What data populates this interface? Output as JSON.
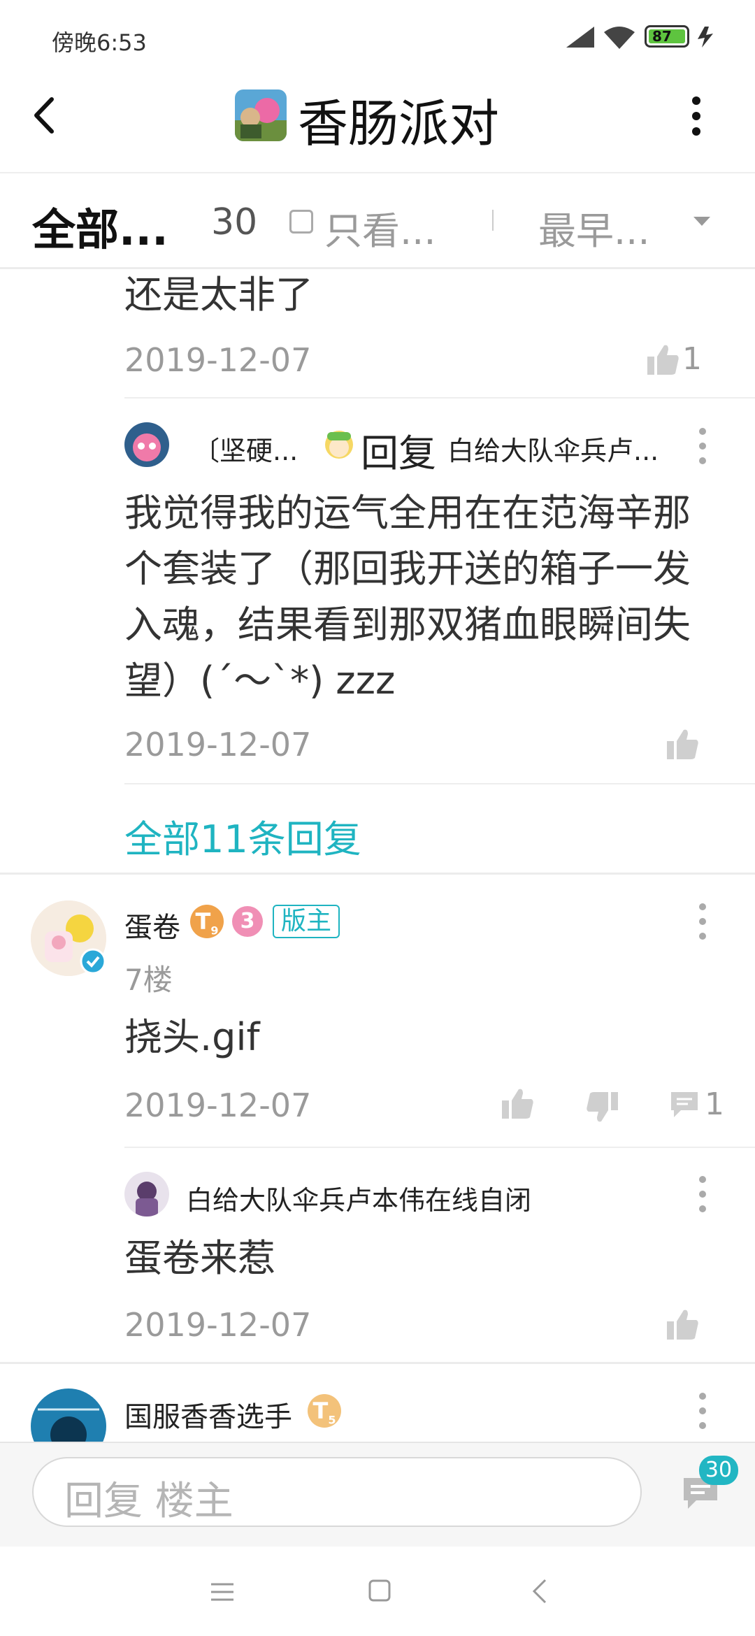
{
  "status_bar": {
    "time": "傍晚6:53",
    "battery": "87"
  },
  "header": {
    "title": "香肠派对"
  },
  "filter": {
    "all_label": "全部...",
    "count": "30",
    "only_label": "只看...",
    "sort_label": "最早..."
  },
  "thread": {
    "prev_reply": {
      "text": "还是太非了",
      "date": "2019-12-07",
      "likes": "1"
    },
    "reply2": {
      "author": "〔坚硬...",
      "reply_word": "回复",
      "reply_to": "白给大队伞兵卢...",
      "text": "我觉得我的运气全用在在范海辛那个套装了（那回我开送的箱子一发入魂，结果看到那双猪血眼瞬间失望）(´～`*) zzz",
      "date": "2019-12-07"
    },
    "view_all": "全部11条回复"
  },
  "post7": {
    "author": "蛋卷",
    "level_badge": "T",
    "level_sub": "9",
    "coin_badge": "3",
    "role_tag": "版主",
    "floor": "7楼",
    "text": "挠头.gif",
    "date": "2019-12-07",
    "comments": "1",
    "reply": {
      "author": "白给大队伞兵卢本伟在线自闭",
      "text": "蛋卷来惹",
      "date": "2019-12-07"
    }
  },
  "post8": {
    "author": "国服香香选手",
    "level_badge": "T",
    "level_sub": "5"
  },
  "bottom": {
    "placeholder": "回复  楼主",
    "comment_count": "30"
  },
  "colors": {
    "accent": "#1fb4c1",
    "badge_orange": "#f0a24a",
    "badge_pink": "#f08fb5"
  }
}
